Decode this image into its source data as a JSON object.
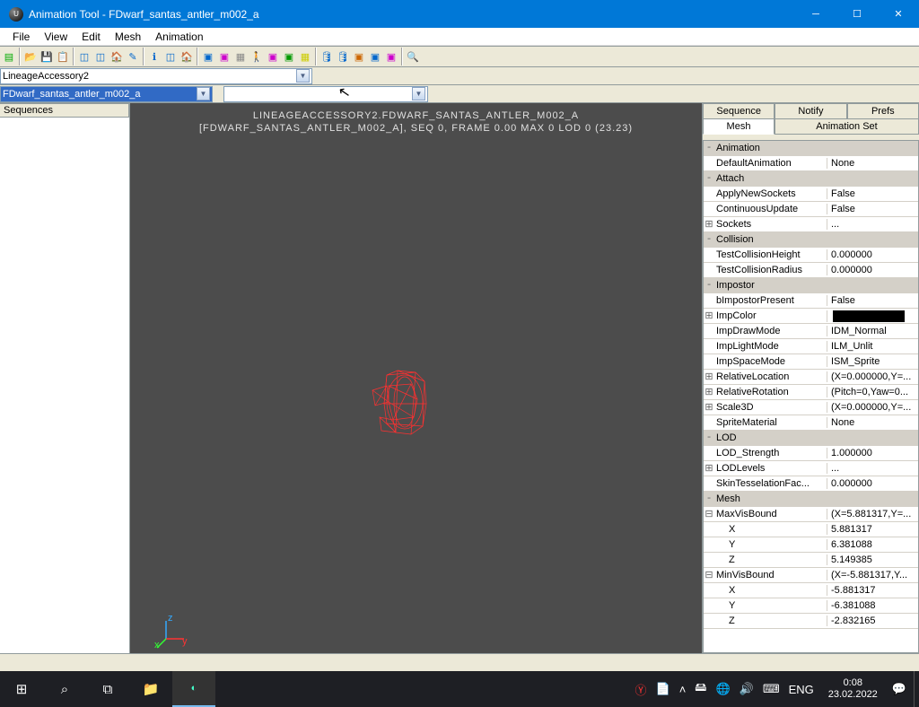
{
  "window": {
    "title": "Animation Tool - FDwarf_santas_antler_m002_a"
  },
  "menu": [
    "File",
    "View",
    "Edit",
    "Mesh",
    "Animation"
  ],
  "combo": {
    "package": "LineageAccessory2",
    "asset": "FDwarf_santas_antler_m002_a",
    "third": ""
  },
  "sequences_label": "Sequences",
  "viewport": {
    "line1": "LINEAGEACCESSORY2.FDWARF_SANTAS_ANTLER_M002_A",
    "line2": "[FDWARF_SANTAS_ANTLER_M002_A], SEQ 0,  FRAME  0.00 MAX 0  LOD 0 (23.23)"
  },
  "tabs_top": [
    "Sequence",
    "Notify",
    "Prefs"
  ],
  "tabs_bottom": [
    "Mesh",
    "Animation Set"
  ],
  "props": [
    {
      "type": "cat",
      "exp": "-",
      "k": "Animation"
    },
    {
      "type": "row",
      "k": "DefaultAnimation",
      "v": "None"
    },
    {
      "type": "cat",
      "exp": "-",
      "k": "Attach"
    },
    {
      "type": "row",
      "k": "ApplyNewSockets",
      "v": "False"
    },
    {
      "type": "row",
      "k": "ContinuousUpdate",
      "v": "False"
    },
    {
      "type": "row",
      "exp": "⊞",
      "k": "Sockets",
      "v": "..."
    },
    {
      "type": "cat",
      "exp": "-",
      "k": "Collision"
    },
    {
      "type": "row",
      "k": "TestCollisionHeight",
      "v": "0.000000"
    },
    {
      "type": "row",
      "k": "TestCollisionRadius",
      "v": "0.000000"
    },
    {
      "type": "cat",
      "exp": "-",
      "k": "Impostor"
    },
    {
      "type": "row",
      "k": "bImpostorPresent",
      "v": "False"
    },
    {
      "type": "color",
      "exp": "⊞",
      "k": "ImpColor"
    },
    {
      "type": "row",
      "k": "ImpDrawMode",
      "v": "IDM_Normal"
    },
    {
      "type": "row",
      "k": "ImpLightMode",
      "v": "ILM_Unlit"
    },
    {
      "type": "row",
      "k": "ImpSpaceMode",
      "v": "ISM_Sprite"
    },
    {
      "type": "row",
      "exp": "⊞",
      "k": "RelativeLocation",
      "v": "(X=0.000000,Y=..."
    },
    {
      "type": "row",
      "exp": "⊞",
      "k": "RelativeRotation",
      "v": "(Pitch=0,Yaw=0..."
    },
    {
      "type": "row",
      "exp": "⊞",
      "k": "Scale3D",
      "v": "(X=0.000000,Y=..."
    },
    {
      "type": "row",
      "k": "SpriteMaterial",
      "v": "None"
    },
    {
      "type": "cat",
      "exp": "-",
      "k": "LOD"
    },
    {
      "type": "row",
      "k": "LOD_Strength",
      "v": "1.000000"
    },
    {
      "type": "row",
      "exp": "⊞",
      "k": "LODLevels",
      "v": "..."
    },
    {
      "type": "row",
      "k": "SkinTesselationFac...",
      "v": "0.000000"
    },
    {
      "type": "cat",
      "exp": "-",
      "k": "Mesh"
    },
    {
      "type": "row",
      "exp": "⊟",
      "k": "MaxVisBound",
      "v": "(X=5.881317,Y=..."
    },
    {
      "type": "row",
      "indent": true,
      "k": "X",
      "v": "5.881317"
    },
    {
      "type": "row",
      "indent": true,
      "k": "Y",
      "v": "6.381088"
    },
    {
      "type": "row",
      "indent": true,
      "k": "Z",
      "v": "5.149385"
    },
    {
      "type": "row",
      "exp": "⊟",
      "k": "MinVisBound",
      "v": "(X=-5.881317,Y..."
    },
    {
      "type": "row",
      "indent": true,
      "k": "X",
      "v": "-5.881317"
    },
    {
      "type": "row",
      "indent": true,
      "k": "Y",
      "v": "-6.381088"
    },
    {
      "type": "row",
      "indent": true,
      "k": "Z",
      "v": "-2.832165"
    }
  ],
  "tray": {
    "lang": "ENG",
    "time": "0:08",
    "date": "23.02.2022"
  }
}
